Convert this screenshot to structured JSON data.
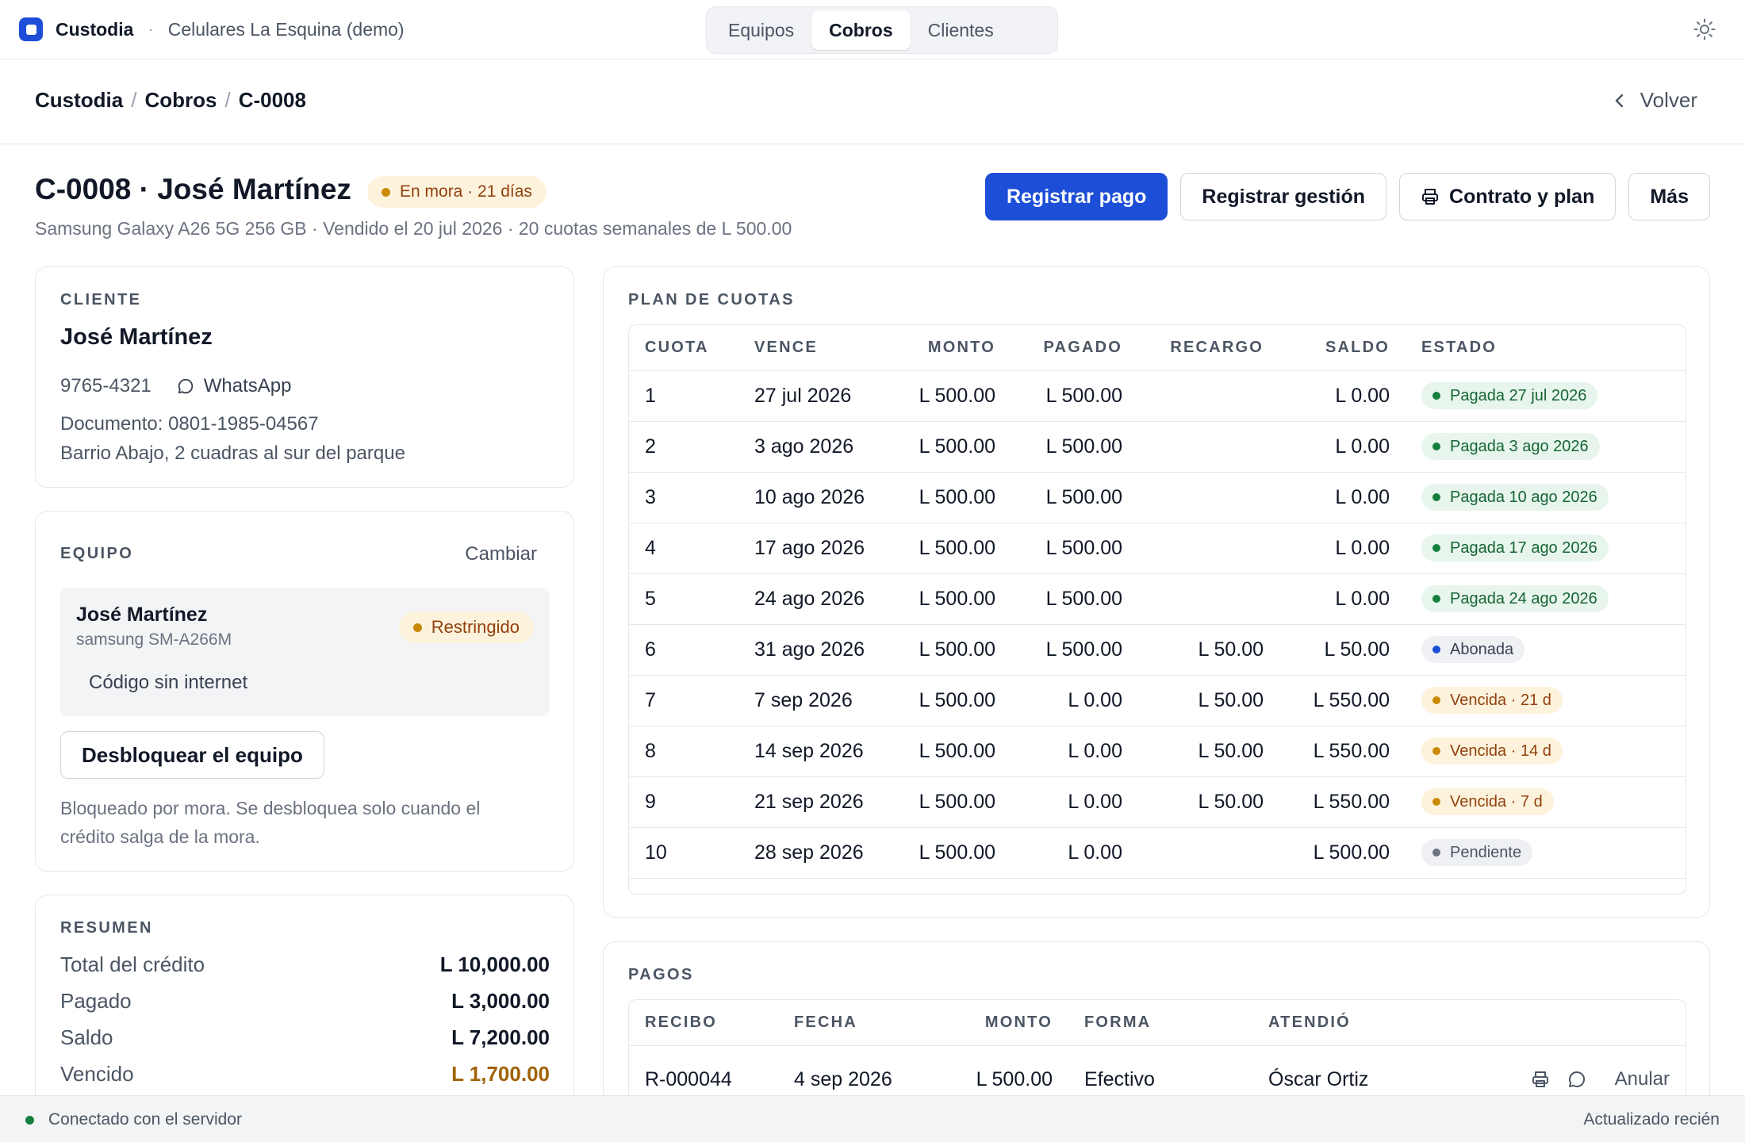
{
  "app": {
    "name": "Custodia",
    "separator": "·",
    "org": "Celulares La Esquina (demo)"
  },
  "nav": {
    "tabs": [
      "Equipos",
      "Cobros",
      "Clientes"
    ],
    "active": "Cobros"
  },
  "breadcrumb": {
    "items": [
      "Custodia",
      "Cobros",
      "C-0008"
    ],
    "separator": "/"
  },
  "back_label": "Volver",
  "credit": {
    "title": "C-0008 · José Martínez",
    "status_badge": "En mora · 21 días",
    "subtitle": "Samsung Galaxy A26 5G 256 GB · Vendido el 20 jul 2026 · 20 cuotas semanales de L 500.00"
  },
  "actions": {
    "register_payment": "Registrar pago",
    "register_action": "Registrar gestión",
    "contract": "Contrato y plan",
    "more": "Más"
  },
  "cliente": {
    "label": "CLIENTE",
    "name": "José Martínez",
    "phone": "9765-4321",
    "whatsapp": "WhatsApp",
    "document": "Documento: 0801-1985-04567",
    "address": "Barrio Abajo, 2 cuadras al sur del parque"
  },
  "equipo": {
    "label": "EQUIPO",
    "change": "Cambiar",
    "owner": "José Martínez",
    "model": "samsung SM-A266M",
    "status": "Restringido",
    "offline_code": "Código sin internet",
    "unlock_button": "Desbloquear el equipo",
    "note": "Bloqueado por mora. Se desbloquea solo cuando el crédito salga de la mora."
  },
  "resumen": {
    "label": "RESUMEN",
    "rows": [
      {
        "label": "Total del crédito",
        "value": "L 10,000.00"
      },
      {
        "label": "Pagado",
        "value": "L 3,000.00"
      },
      {
        "label": "Saldo",
        "value": "L 7,200.00"
      },
      {
        "label": "Vencido",
        "value": "L 1,700.00"
      }
    ]
  },
  "plan": {
    "label": "PLAN DE CUOTAS",
    "columns": [
      "CUOTA",
      "VENCE",
      "MONTO",
      "PAGADO",
      "RECARGO",
      "SALDO",
      "ESTADO"
    ],
    "rows": [
      {
        "cuota": "1",
        "vence": "27 jul 2026",
        "monto": "L 500.00",
        "pagado": "L 500.00",
        "recargo": "",
        "saldo": "L 0.00",
        "estado": "Pagada 27 jul 2026",
        "tone": "green"
      },
      {
        "cuota": "2",
        "vence": "3 ago 2026",
        "monto": "L 500.00",
        "pagado": "L 500.00",
        "recargo": "",
        "saldo": "L 0.00",
        "estado": "Pagada 3 ago 2026",
        "tone": "green"
      },
      {
        "cuota": "3",
        "vence": "10 ago 2026",
        "monto": "L 500.00",
        "pagado": "L 500.00",
        "recargo": "",
        "saldo": "L 0.00",
        "estado": "Pagada 10 ago 2026",
        "tone": "green"
      },
      {
        "cuota": "4",
        "vence": "17 ago 2026",
        "monto": "L 500.00",
        "pagado": "L 500.00",
        "recargo": "",
        "saldo": "L 0.00",
        "estado": "Pagada 17 ago 2026",
        "tone": "green"
      },
      {
        "cuota": "5",
        "vence": "24 ago 2026",
        "monto": "L 500.00",
        "pagado": "L 500.00",
        "recargo": "",
        "saldo": "L 0.00",
        "estado": "Pagada 24 ago 2026",
        "tone": "green"
      },
      {
        "cuota": "6",
        "vence": "31 ago 2026",
        "monto": "L 500.00",
        "pagado": "L 500.00",
        "recargo": "L 50.00",
        "saldo": "L 50.00",
        "estado": "Abonada",
        "tone": "blue"
      },
      {
        "cuota": "7",
        "vence": "7 sep 2026",
        "monto": "L 500.00",
        "pagado": "L 0.00",
        "recargo": "L 50.00",
        "saldo": "L 550.00",
        "estado": "Vencida · 21 d",
        "tone": "amber"
      },
      {
        "cuota": "8",
        "vence": "14 sep 2026",
        "monto": "L 500.00",
        "pagado": "L 0.00",
        "recargo": "L 50.00",
        "saldo": "L 550.00",
        "estado": "Vencida · 14 d",
        "tone": "amber"
      },
      {
        "cuota": "9",
        "vence": "21 sep 2026",
        "monto": "L 500.00",
        "pagado": "L 0.00",
        "recargo": "L 50.00",
        "saldo": "L 550.00",
        "estado": "Vencida · 7 d",
        "tone": "amber"
      },
      {
        "cuota": "10",
        "vence": "28 sep 2026",
        "monto": "L 500.00",
        "pagado": "L 0.00",
        "recargo": "",
        "saldo": "L 500.00",
        "estado": "Pendiente",
        "tone": "gray"
      }
    ]
  },
  "pagos": {
    "label": "PAGOS",
    "columns": [
      "RECIBO",
      "FECHA",
      "MONTO",
      "FORMA",
      "ATENDIÓ"
    ],
    "rows": [
      {
        "recibo": "R-000044",
        "fecha": "4 sep 2026",
        "monto": "L 500.00",
        "forma": "Efectivo",
        "atendio": "Óscar Ortiz",
        "void": "Anular"
      }
    ]
  },
  "status": {
    "connection": "Conectado con el servidor",
    "updated": "Actualizado recién"
  },
  "colors": {
    "accent": "#1d4ed8",
    "warning": "#92400e",
    "success": "#166534"
  }
}
